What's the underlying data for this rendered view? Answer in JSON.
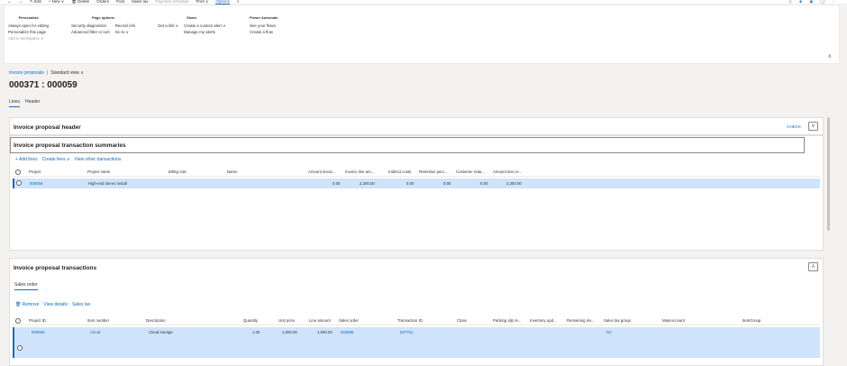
{
  "topbar": {
    "items": [
      "←",
      "→",
      "✎ Edit",
      "+ New ∨",
      "🗑 Delete",
      "Orders",
      "Post",
      "Sales tax",
      "Payment schedule",
      "Print ∨",
      "Options",
      "⌕"
    ],
    "icons": [
      "◇",
      "◈",
      "◉",
      "◯",
      "◌"
    ]
  },
  "ribbon": {
    "personalize": {
      "title": "Personalize",
      "items": [
        "Always open for editing",
        "Personalize this page",
        "Add to workspace ∨"
      ]
    },
    "page_options": {
      "title": "Page options",
      "col1": [
        "Security diagnostics",
        "Advanced filter or sort"
      ],
      "col2": [
        "Record info",
        "Go to ∨"
      ]
    },
    "share": {
      "title": "Share",
      "col1": [
        "Get a link ∨"
      ],
      "col2": [
        "Create a custom alert ∨",
        "Manage my alerts"
      ]
    },
    "power_automate": {
      "title": "Power Automate",
      "items": [
        "See your flows",
        "Create a flow"
      ]
    },
    "collapse_glyph": "∧"
  },
  "breadcrumb": {
    "link": "Invoice proposals",
    "sep": "|",
    "view": "Standard view ∨"
  },
  "page_title": "000371 : 000059",
  "tabs": [
    "Lines",
    "Header"
  ],
  "header_section": {
    "title": "Invoice proposal header",
    "check_label": "CHECK",
    "chevron": "∨"
  },
  "summaries": {
    "title": "Invoice proposal transaction summaries",
    "actions": [
      "+ Add lines",
      "Create fees ∨",
      "View other transactions"
    ],
    "columns": [
      "Project",
      "Project name",
      "Billing rule",
      "Name",
      "Amount invoic...",
      "Invoice line am...",
      "Indirect costs",
      "Retention perc...",
      "Customer retai...",
      "Amount less re..."
    ],
    "rows": [
      {
        "project": "000059",
        "project_name": "High-end stereo install",
        "billing_rule": "",
        "name": "",
        "amount_invoiced": "0.00",
        "invoice_line_amount": "2,200.00",
        "indirect_costs": "0.00",
        "retention": "0.00",
        "customer_retained": "0.00",
        "amount_less": "2,200.00"
      }
    ]
  },
  "transactions": {
    "title": "Invoice proposal transactions",
    "chevron": "∧",
    "subtab": "Sales order",
    "actions": [
      "🗑 Remove",
      "View details",
      "Sales tax"
    ],
    "columns": [
      "Project ID",
      "Item number",
      "Description",
      "Quantity",
      "Unit price",
      "Line amount",
      "Sales order",
      "Transaction ID",
      "Close",
      "Packing slip re...",
      "Inventory upd...",
      "Remaining inv...",
      "Sales tax group",
      "MainAccount",
      "ItemGroup"
    ],
    "rows": [
      {
        "project_id": "000059",
        "item_number": "Cloud",
        "description": "Cloud storage",
        "quantity": "1.00",
        "unit_price": "1,000.00",
        "line_amount": "1,000.00",
        "sales_order": "004888",
        "transaction_id": "007791",
        "sales_tax_group": "NV"
      }
    ]
  },
  "colors": {
    "accent": "#0f6cbd",
    "selected_row": "#cfe4fa",
    "background": "#f3f2f1"
  }
}
